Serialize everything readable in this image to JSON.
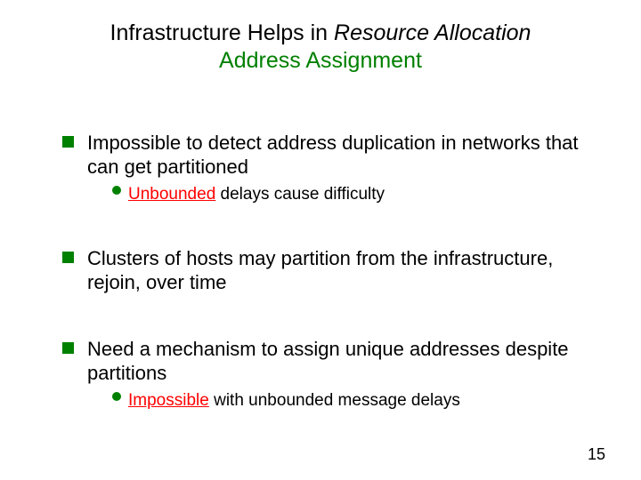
{
  "title": {
    "line1_pre": "Infrastructure Helps in ",
    "line1_italic": "Resource Allocation",
    "line2": "Address Assignment"
  },
  "bullets": [
    {
      "text": "Impossible to detect address duplication in networks that can get partitioned",
      "sub": {
        "prefix": "",
        "emph": "Unbounded",
        "rest": " delays cause difficulty"
      }
    },
    {
      "text": "Clusters of hosts may partition from the infrastructure, rejoin, over time",
      "sub": null
    },
    {
      "text": "Need a mechanism to assign unique addresses despite partitions",
      "sub": {
        "prefix": "",
        "emph": "Impossible",
        "rest": " with unbounded message delays"
      }
    }
  ],
  "page_number": "15"
}
